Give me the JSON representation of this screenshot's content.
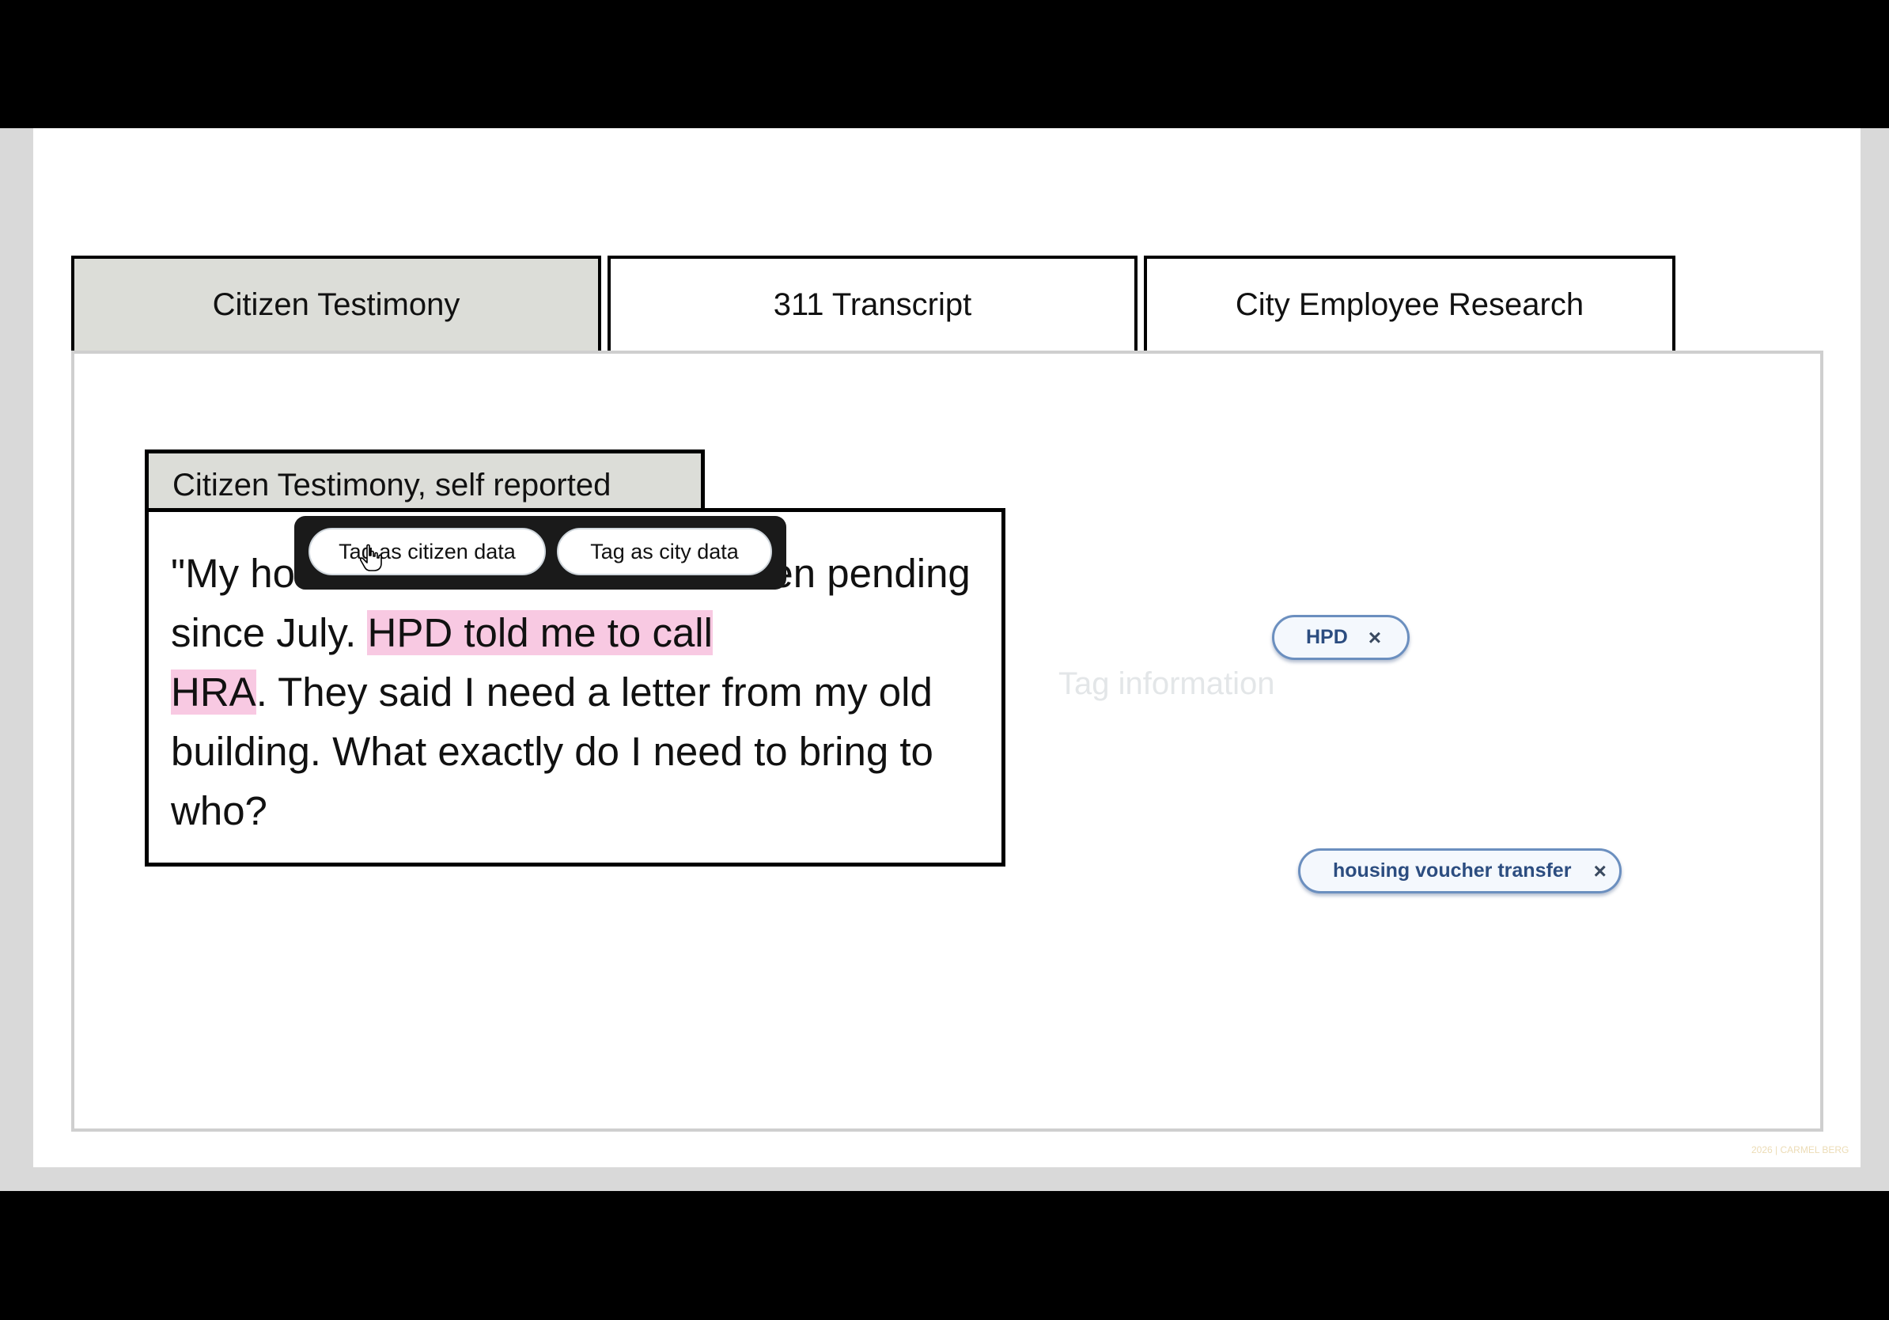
{
  "tabs": [
    {
      "label": "Citizen Testimony",
      "active": true
    },
    {
      "label": "311 Transcript",
      "active": false
    },
    {
      "label": "City Employee Research",
      "active": false
    }
  ],
  "card": {
    "header": "Citizen Testimony, self reported",
    "text_part1": "\"My ho",
    "text_part2": "s been pending since July. ",
    "highlight1": "HPD told me to call ",
    "highlight2": "HRA",
    "text_part3": ". They said I need a letter from my old building. What exactly do I need to bring to who?"
  },
  "popup": {
    "citizen_button": "Tag as citizen data",
    "city_button": "Tag as city data"
  },
  "tag_area": {
    "placeholder": "Tag information"
  },
  "tags": [
    {
      "label": "HPD",
      "remove": "×"
    },
    {
      "label": "housing voucher transfer",
      "remove": "×"
    }
  ],
  "watermark": "2026 | CARMEL BERG",
  "colors": {
    "active_tab": "#dcddd8",
    "highlight": "#f8c9e2",
    "chip_border": "#6b8fbf",
    "chip_text": "#2c4d80"
  }
}
